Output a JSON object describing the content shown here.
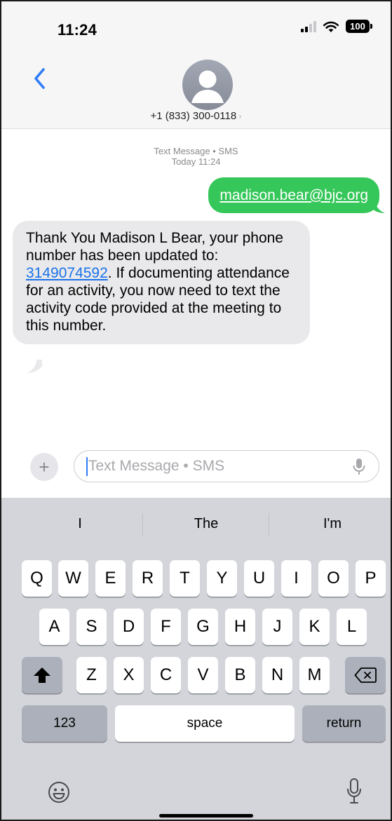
{
  "status": {
    "time": "11:24",
    "battery": "100"
  },
  "header": {
    "contact": "+1 (833) 300-0118",
    "chevron": "›"
  },
  "thread": {
    "meta_line1": "Text Message • SMS",
    "meta_line2": "Today 11:24",
    "outgoing": {
      "text": "madison.bear@bjc.org"
    },
    "incoming": {
      "before": "Thank You Madison L Bear, your phone number has been updated to: ",
      "phone": "3149074592",
      "after": ". If documenting attendance for an activity, you now need to text the activity code provided at the meeting to this number."
    }
  },
  "compose": {
    "plus": "+",
    "placeholder": "Text Message • SMS"
  },
  "keyboard": {
    "suggestions": [
      "I",
      "The",
      "I'm"
    ],
    "row1": [
      "Q",
      "W",
      "E",
      "R",
      "T",
      "Y",
      "U",
      "I",
      "O",
      "P"
    ],
    "row2": [
      "A",
      "S",
      "D",
      "F",
      "G",
      "H",
      "J",
      "K",
      "L"
    ],
    "row3": [
      "Z",
      "X",
      "C",
      "V",
      "B",
      "N",
      "M"
    ],
    "numbers": "123",
    "space": "space",
    "return": "return"
  },
  "colors": {
    "outgoing_bubble": "#35c759",
    "incoming_bubble": "#e9e9eb",
    "link": "#1a73e8",
    "accent": "#2f7cf6"
  },
  "icons": [
    "signal-icon",
    "wifi-icon",
    "battery-icon",
    "back-chevron-icon",
    "avatar-icon",
    "microphone-icon",
    "shift-icon",
    "delete-icon",
    "emoji-icon",
    "dictation-icon"
  ]
}
